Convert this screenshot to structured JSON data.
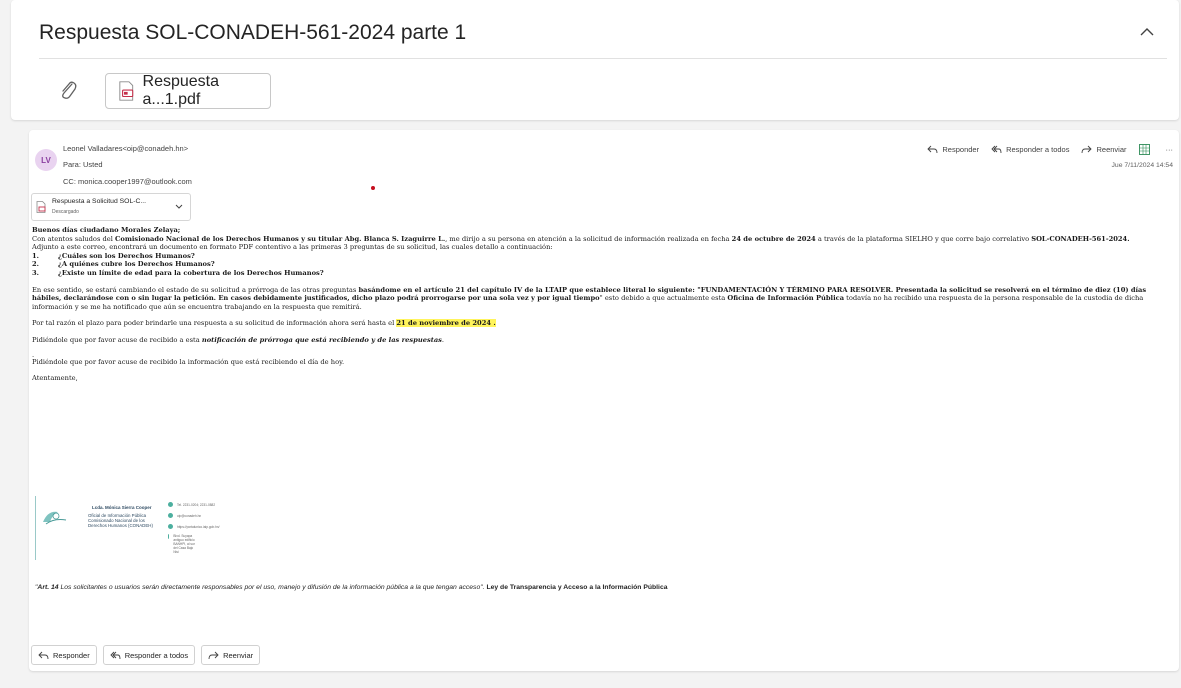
{
  "thread": {
    "subject": "Respuesta SOL-CONADEH-561-2024 parte 1",
    "attachment_name": "Respuesta a...1.pdf",
    "icons": [
      "chevron-up-icon",
      "paperclip-icon",
      "pdf-file-icon"
    ]
  },
  "message": {
    "avatar_initials": "LV",
    "from": "Leonel Valladares<oip@conadeh.hn>",
    "to": "Para: Usted",
    "cc": "CC: monica.cooper1997@outlook.com",
    "date": "Jue 7/11/2024 14:54",
    "attachment": {
      "name": "Respuesta a Solicitud SOL-C...",
      "status": "Descargado"
    },
    "actions": {
      "reply": "Responder",
      "reply_all": "Responder a todos",
      "forward": "Reenviar",
      "more": "···"
    },
    "colors": {
      "avatar_bg": "#e9d3f0",
      "highlight": "#fff45c"
    }
  },
  "body": {
    "greeting": "Buenos días ciudadano Morales Zelaya;",
    "p1_a": "Con atentos saludos del ",
    "p1_b": "Comisionado Nacional de los Derechos Humanos y su titular Abg. Blanca S. Izaguirre L.",
    "p1_c": ", me dirijo a su persona en atención a la solicitud de información realizada en fecha ",
    "p1_d": "24 de octubre de 2024",
    "p1_e": " a través de la plataforma SIELHO y que corre bajo correlativo ",
    "p1_f": "SOL-CONADEH-561-2024.",
    "p2": "Adjunto a este correo, encontrará un documento en formato PDF contentivo a las primeras 3 preguntas de su solicitud, las cuales detallo a continuación:",
    "list": [
      {
        "num": "1.",
        "text": "¿Cuáles son los Derechos Humanos?"
      },
      {
        "num": "2.",
        "text": "¿A quiénes cubre los Derechos Humanos?"
      },
      {
        "num": "3.",
        "text": "¿Existe un límite de edad para la cobertura de los Derechos Humanos?"
      }
    ],
    "p3_a": "En ese sentido,  se estará cambiando el estado de su solicitud a prórroga de las otras preguntas ",
    "p3_b": "basándome en el artículo 21 del capítulo IV de la LTAIP que establece literal lo siguiente: \"FUNDAMENTACIÓN Y TÉRMINO PARA RESOLVER. Presentada la solicitud se resolverá en el término de diez (10) días hábiles, declarándose con o sin lugar la petición. En casos debidamente justificados, dicho plazo podrá prorrogarse por una sola vez y por igual tiempo",
    "p3_c": "\" esto debido a que actualmente esta ",
    "p3_d": "Oficina de Información Pública",
    "p3_e": " todavía no ha recibido una respuesta de la persona responsable de la custodia de dicha información y se me ha notificado que aún se encuentra trabajando en la respuesta que remitirá.",
    "p4_a": "Por tal razón el plazo para poder brindarle una respuesta a su solicitud de información ahora será hasta el ",
    "p4_b": "21 de noviembre de 2024 .",
    "p5_a": "Pidiéndole que por favor acuse de recibido a esta ",
    "p5_b": "notificación de prórroga que está recibiendo y de las respuestas",
    "p5_c": ".",
    "p6_dot": ".",
    "p6": "Pidiéndole que por favor acuse de recibido la información que está recibiendo el día de hoy.",
    "closing": "Atentamente,"
  },
  "signature": {
    "name": "Lcda. Mónica Sierra Cooper",
    "title": "Oficial de Información Pública Comisionado Nacional de los Derechos Humanos (CONADEH)",
    "contacts": [
      "Tel. 2231-0204; 2231-0882",
      "oip@conadeh.hn",
      "https://portalunico.iaip.gob.hn/",
      "Blvd. Suyapa antiguo edificio BANHPI, al sur del Casa Bajo Nisi"
    ]
  },
  "law": {
    "a": "\"",
    "b": "Art. 14",
    "c": " Los solicitantes o usuarios serán directamente responsables por el uso, manejo y difusión de la información pública a la que tengan acceso\". ",
    "d": "Ley de Transparencia y Acceso a la Información Pública"
  },
  "bottom": {
    "reply": "Responder",
    "reply_all": "Responder a todos",
    "forward": "Reenviar"
  }
}
